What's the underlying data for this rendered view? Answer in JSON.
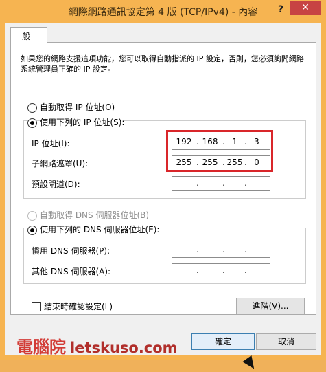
{
  "window": {
    "title": "網際網路通訊協定第 4 版 (TCP/IPv4) - 內容",
    "help_symbol": "?",
    "close_symbol": "✕"
  },
  "tabs": [
    {
      "label": "一般"
    }
  ],
  "description": "如果您的網路支援這項功能，您可以取得自動指派的 IP 設定，否則，您必須詢問網路系統管理員正確的 IP 設定。",
  "ip": {
    "auto_label": "自動取得 IP 位址(O)",
    "manual_label": "使用下列的 IP 位址(S):",
    "address_label": "IP 位址(I):",
    "mask_label": "子網路遮罩(U):",
    "gateway_label": "預設閘道(D):",
    "address_octets": [
      "192",
      "168",
      "1",
      "3"
    ],
    "mask_octets": [
      "255",
      "255",
      "255",
      "0"
    ],
    "gateway_octets": [
      "",
      "",
      "",
      ""
    ]
  },
  "dns": {
    "auto_label": "自動取得 DNS 伺服器位址(B)",
    "manual_label": "使用下列的 DNS 伺服器位址(E):",
    "preferred_label": "慣用 DNS 伺服器(P):",
    "alternate_label": "其他 DNS 伺服器(A):",
    "preferred_octets": [
      "",
      "",
      "",
      ""
    ],
    "alternate_octets": [
      "",
      "",
      "",
      ""
    ]
  },
  "validate_label": "結束時確認設定(L)",
  "advanced_label": "進階(V)...",
  "ok_label": "確定",
  "cancel_label": "取消",
  "watermark": {
    "chinese": "電腦院",
    "site": "letskuso.com"
  },
  "colors": {
    "highlight": "#d9262a",
    "watermark": "#d23b35",
    "close": "#c74343"
  }
}
